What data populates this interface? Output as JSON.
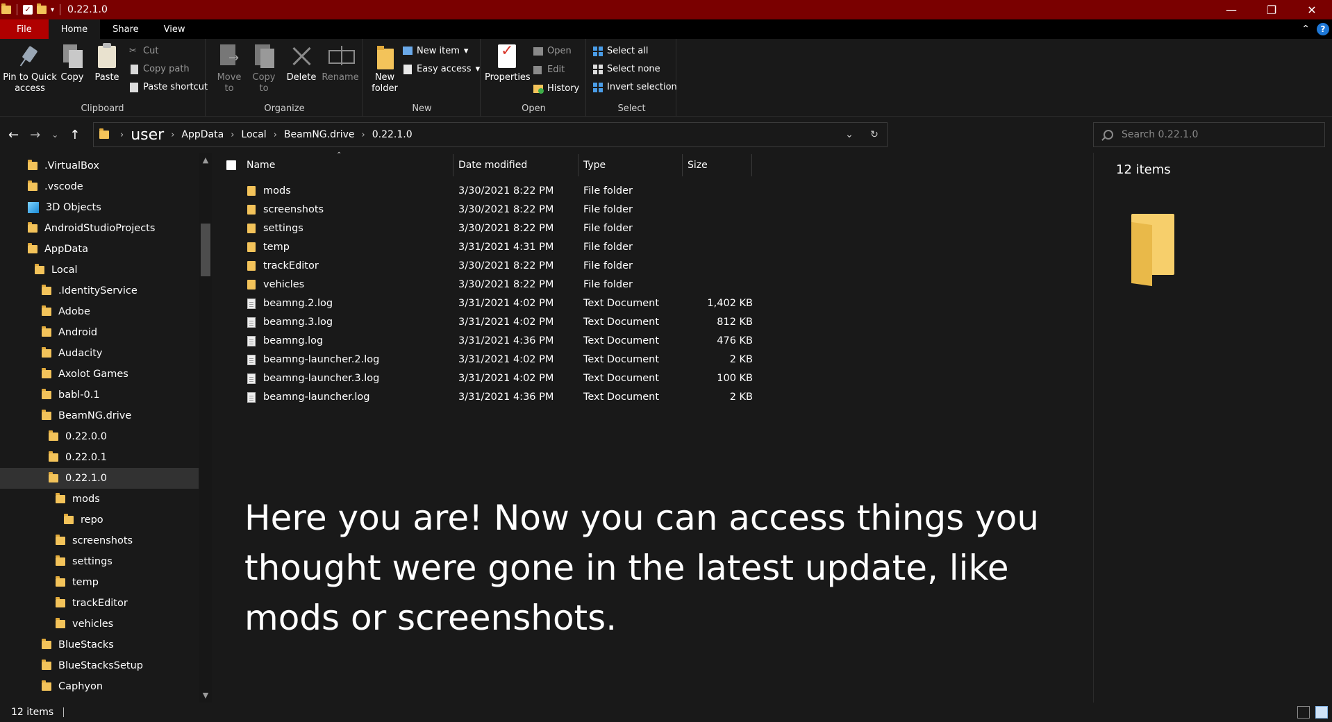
{
  "window": {
    "title": "0.22.1.0",
    "controls": [
      "—",
      "❐",
      "✕"
    ]
  },
  "ribbon_tabs": [
    "File",
    "Home",
    "Share",
    "View"
  ],
  "ribbon": {
    "clipboard": {
      "label": "Clipboard",
      "pin": "Pin to Quick access",
      "copy": "Copy",
      "paste": "Paste",
      "cut": "Cut",
      "copy_path": "Copy path",
      "paste_shortcut": "Paste shortcut"
    },
    "organize": {
      "label": "Organize",
      "move_to": "Move to",
      "copy_to": "Copy to",
      "delete": "Delete",
      "rename": "Rename"
    },
    "new": {
      "label": "New",
      "new_folder": "New folder",
      "new_item": "New item",
      "easy_access": "Easy access"
    },
    "open": {
      "label": "Open",
      "properties": "Properties",
      "open": "Open",
      "edit": "Edit",
      "history": "History"
    },
    "select": {
      "label": "Select",
      "select_all": "Select all",
      "select_none": "Select none",
      "invert": "Invert selection"
    }
  },
  "address": {
    "crumbs": [
      "user",
      "AppData",
      "Local",
      "BeamNG.drive",
      "0.22.1.0"
    ]
  },
  "search": {
    "placeholder": "Search 0.22.1.0"
  },
  "nav_tree": [
    {
      "label": ".VirtualBox",
      "icon": "folder-icon",
      "selected": false
    },
    {
      "label": ".vscode",
      "icon": "folder-icon",
      "selected": false
    },
    {
      "label": "3D Objects",
      "icon": "cube-icon",
      "selected": false
    },
    {
      "label": "AndroidStudioProjects",
      "icon": "folder-icon",
      "selected": false
    },
    {
      "label": "AppData",
      "icon": "folder-icon",
      "selected": false
    },
    {
      "label": "Local",
      "icon": "folder-icon",
      "selected": false
    },
    {
      "label": ".IdentityService",
      "icon": "folder-icon",
      "selected": false
    },
    {
      "label": "Adobe",
      "icon": "folder-icon",
      "selected": false
    },
    {
      "label": "Android",
      "icon": "folder-icon",
      "selected": false
    },
    {
      "label": "Audacity",
      "icon": "folder-icon",
      "selected": false
    },
    {
      "label": "Axolot Games",
      "icon": "folder-icon",
      "selected": false
    },
    {
      "label": "babl-0.1",
      "icon": "folder-icon",
      "selected": false
    },
    {
      "label": "BeamNG.drive",
      "icon": "folder-icon",
      "selected": false
    },
    {
      "label": "0.22.0.0",
      "icon": "folder-icon",
      "selected": false
    },
    {
      "label": "0.22.0.1",
      "icon": "folder-icon",
      "selected": false
    },
    {
      "label": "0.22.1.0",
      "icon": "folder-icon",
      "selected": true
    },
    {
      "label": "mods",
      "icon": "folder-icon",
      "selected": false
    },
    {
      "label": "repo",
      "icon": "folder-icon",
      "selected": false
    },
    {
      "label": "screenshots",
      "icon": "folder-icon",
      "selected": false
    },
    {
      "label": "settings",
      "icon": "folder-icon",
      "selected": false
    },
    {
      "label": "temp",
      "icon": "folder-icon",
      "selected": false
    },
    {
      "label": "trackEditor",
      "icon": "folder-icon",
      "selected": false
    },
    {
      "label": "vehicles",
      "icon": "folder-icon",
      "selected": false
    },
    {
      "label": "BlueStacks",
      "icon": "folder-icon",
      "selected": false
    },
    {
      "label": "BlueStacksSetup",
      "icon": "folder-icon",
      "selected": false
    },
    {
      "label": "Caphyon",
      "icon": "folder-icon",
      "selected": false
    }
  ],
  "columns": {
    "name": "Name",
    "date": "Date modified",
    "type": "Type",
    "size": "Size"
  },
  "files": [
    {
      "name": "mods",
      "date": "3/30/2021 8:22 PM",
      "type": "File folder",
      "size": "",
      "kind": "folder"
    },
    {
      "name": "screenshots",
      "date": "3/30/2021 8:22 PM",
      "type": "File folder",
      "size": "",
      "kind": "folder"
    },
    {
      "name": "settings",
      "date": "3/30/2021 8:22 PM",
      "type": "File folder",
      "size": "",
      "kind": "folder"
    },
    {
      "name": "temp",
      "date": "3/31/2021 4:31 PM",
      "type": "File folder",
      "size": "",
      "kind": "folder"
    },
    {
      "name": "trackEditor",
      "date": "3/30/2021 8:22 PM",
      "type": "File folder",
      "size": "",
      "kind": "folder"
    },
    {
      "name": "vehicles",
      "date": "3/30/2021 8:22 PM",
      "type": "File folder",
      "size": "",
      "kind": "folder"
    },
    {
      "name": "beamng.2.log",
      "date": "3/31/2021 4:02 PM",
      "type": "Text Document",
      "size": "1,402 KB",
      "kind": "doc"
    },
    {
      "name": "beamng.3.log",
      "date": "3/31/2021 4:02 PM",
      "type": "Text Document",
      "size": "812 KB",
      "kind": "doc"
    },
    {
      "name": "beamng.log",
      "date": "3/31/2021 4:36 PM",
      "type": "Text Document",
      "size": "476 KB",
      "kind": "doc"
    },
    {
      "name": "beamng-launcher.2.log",
      "date": "3/31/2021 4:02 PM",
      "type": "Text Document",
      "size": "2 KB",
      "kind": "doc"
    },
    {
      "name": "beamng-launcher.3.log",
      "date": "3/31/2021 4:02 PM",
      "type": "Text Document",
      "size": "100 KB",
      "kind": "doc"
    },
    {
      "name": "beamng-launcher.log",
      "date": "3/31/2021 4:36 PM",
      "type": "Text Document",
      "size": "2 KB",
      "kind": "doc"
    }
  ],
  "caption": "Here you are! Now you can access things you thought were gone in the latest update, like mods or screenshots.",
  "details": {
    "count": "12 items"
  },
  "status": {
    "count": "12 items"
  },
  "colors": {
    "titlebar": "#7a0000",
    "file_tab": "#b00000",
    "folder": "#f3c35a",
    "background": "#191919"
  }
}
